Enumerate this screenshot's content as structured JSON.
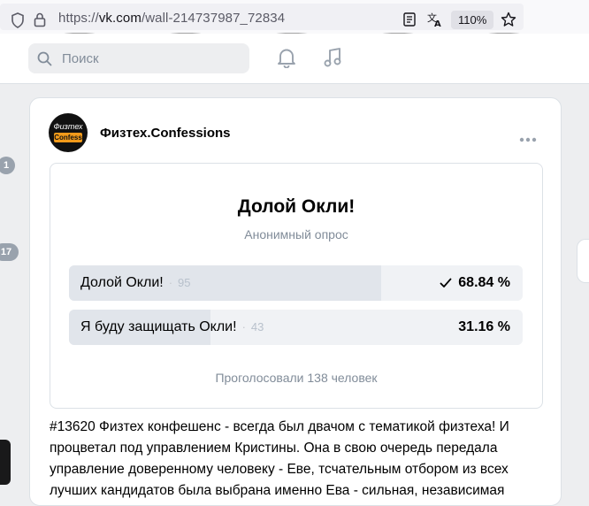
{
  "browser": {
    "url_prefix": "https://",
    "url_host": "vk.com",
    "url_path": "/wall-214737987_72834",
    "zoom": "110%"
  },
  "header": {
    "search_placeholder": "Поиск"
  },
  "side": {
    "badge_1": "1",
    "badge_2": "17"
  },
  "post": {
    "group_name": "Физтех.Confessions",
    "avatar_top": "Физтех",
    "avatar_mid": "Confess",
    "poll": {
      "title": "Долой Окли!",
      "subtitle": "Анонимный опрос",
      "options": [
        {
          "label": "Долой Окли!",
          "count": "95",
          "percent": "68.84 %",
          "fraction": 0.6884,
          "selected": true
        },
        {
          "label": "Я буду защищать Окли!",
          "count": "43",
          "percent": "31.16 %",
          "fraction": 0.3116,
          "selected": false
        }
      ],
      "footer": "Проголосовали 138 человек"
    },
    "text": "#13620 Физтех конфешенс - всегда был двачом с тематикой физтеха! И процветал под управлением Кристины. Она в свою очередь передала управление доверенному человеку - Еве, тсчательным отбором из всех лучших кандидатов была выбрана именно Ева - сильная, независимая"
  },
  "colors": {
    "accent": "#2688eb",
    "muted": "#818c99"
  }
}
